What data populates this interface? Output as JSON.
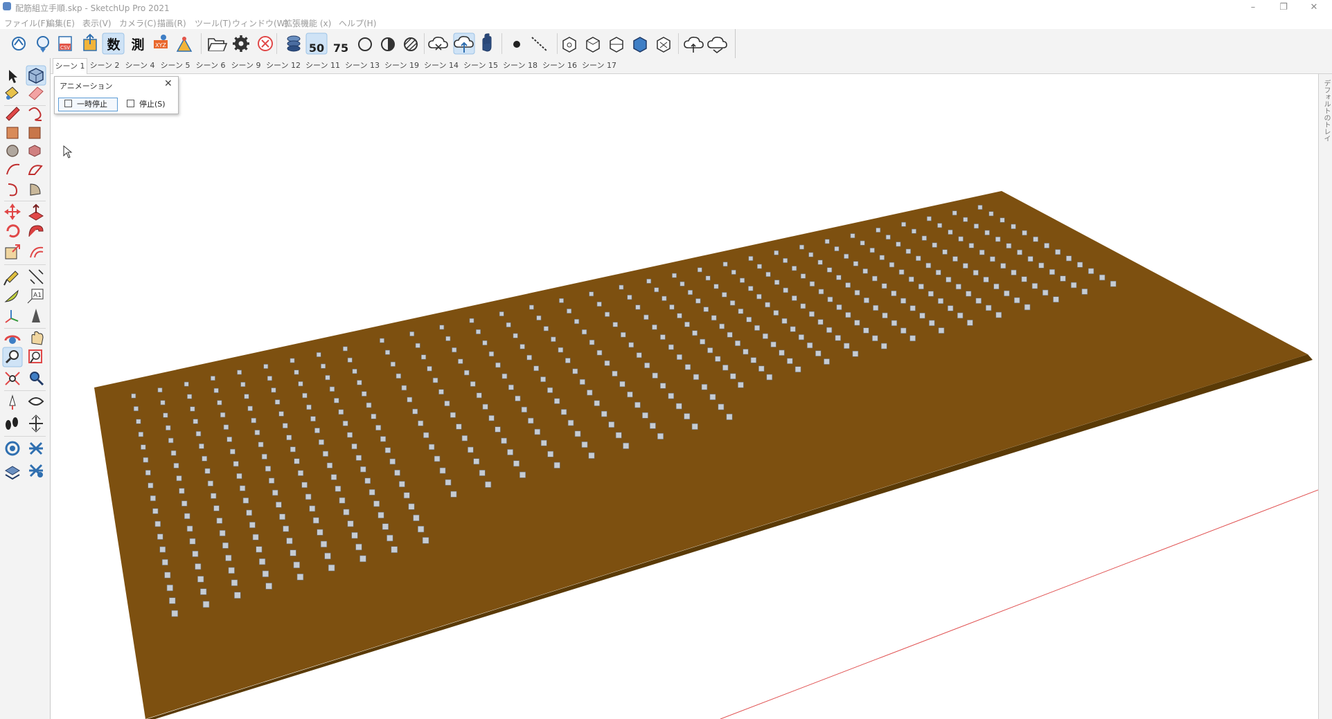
{
  "window": {
    "title": "配筋組立手順.skp - SketchUp Pro 2021",
    "controls": {
      "minimize": "–",
      "restore": "❐",
      "close": "✕"
    }
  },
  "menu": [
    "ファイル(F)",
    "編集(E)",
    "表示(V)",
    "カメラ(C)",
    "描画(R)",
    "ツール(T)",
    "ウィンドウ(W)",
    "拡張機能 (x)",
    "ヘルプ(H)"
  ],
  "toolbar": {
    "buttons": [
      {
        "icon": "model-info-icon"
      },
      {
        "icon": "geo-location-icon"
      },
      {
        "icon": "export-csv-icon"
      },
      {
        "icon": "export-icon"
      },
      {
        "icon": "number-tag-icon",
        "glyph": "数"
      },
      {
        "icon": "measure-tag-icon",
        "glyph": "測"
      },
      {
        "icon": "xyz-icon"
      },
      {
        "icon": "survey-icon"
      },
      {
        "icon": "open-folder-icon"
      },
      {
        "icon": "settings-gear-icon"
      },
      {
        "icon": "cancel-icon"
      },
      {
        "icon": "rebar-layer-icon"
      },
      {
        "icon": "rebar-50-icon",
        "glyph": "50"
      },
      {
        "icon": "rebar-75-icon",
        "glyph": "75"
      },
      {
        "icon": "circle-outline-icon"
      },
      {
        "icon": "half-circle-icon"
      },
      {
        "icon": "hatch-circle-icon"
      },
      {
        "icon": "cloud-remove-icon"
      },
      {
        "icon": "cloud-upload-icon"
      },
      {
        "icon": "hand-icon"
      },
      {
        "icon": "dot-icon"
      },
      {
        "icon": "dashed-line-icon"
      },
      {
        "icon": "iso-view-icon"
      },
      {
        "icon": "top-view-icon"
      },
      {
        "icon": "front-view-icon"
      },
      {
        "icon": "right-view-icon"
      },
      {
        "icon": "back-view-icon"
      },
      {
        "icon": "cloud-sync-icon"
      },
      {
        "icon": "cloud-check-icon"
      }
    ]
  },
  "scenes": {
    "active": 0,
    "tabs": [
      "シーン 1",
      "シーン 2",
      "シーン 4",
      "シーン 5",
      "シーン 6",
      "シーン 9",
      "シーン 12",
      "シーン 11",
      "シーン 13",
      "シーン 19",
      "シーン 14",
      "シーン 15",
      "シーン 18",
      "シーン 16",
      "シーン 17"
    ]
  },
  "left_toolbar": [
    "select-arrow-icon",
    "component-icon",
    "paint-bucket-icon",
    "eraser-icon",
    "pencil-line-icon",
    "freehand-icon",
    "rectangle-icon",
    "rotated-rectangle-icon",
    "circle-icon",
    "polygon-icon",
    "arc-icon",
    "two-point-arc-icon",
    "three-point-arc-icon",
    "pie-icon",
    "move-icon",
    "push-pull-icon",
    "rotate-icon",
    "follow-me-icon",
    "scale-icon",
    "offset-icon",
    "tape-measure-icon",
    "dimension-icon",
    "protractor-icon",
    "text-icon",
    "axes-icon",
    "3d-text-icon",
    "orbit-icon",
    "pan-icon",
    "zoom-icon",
    "zoom-window-icon",
    "zoom-extents-icon",
    "previous-view-icon",
    "position-camera-icon",
    "look-around-icon",
    "walk-icon",
    "section-plane-icon",
    "warehouse-icon",
    "extension-warehouse-icon",
    "layout-icon",
    "extension-manager-icon"
  ],
  "animation_dialog": {
    "title": "アニメーション",
    "pause_label": "一時停止",
    "stop_label": "停止(S)"
  },
  "tray": {
    "label": "デフォルトのトレイ"
  },
  "colors": {
    "slab_top": "#7d5010",
    "slab_side": "#5a3a06",
    "rebar_chair": "#c6ccd3",
    "axis_red": "#e05050",
    "toolbar_bg": "#f3f3f3",
    "selection_blue": "#cfe3f6"
  }
}
